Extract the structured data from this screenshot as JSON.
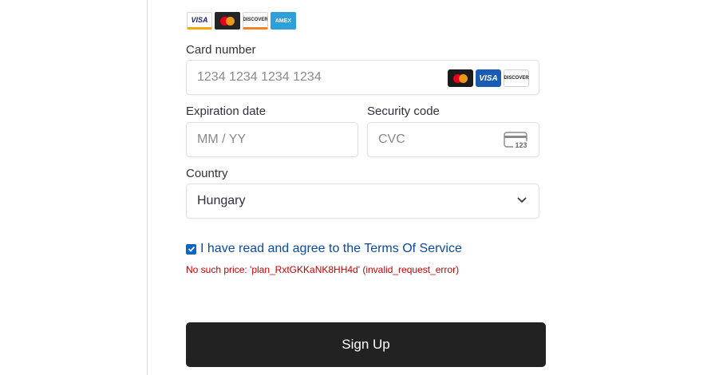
{
  "accepted_brands": [
    {
      "name": "VISA",
      "icon": "visa-icon"
    },
    {
      "name": "MasterCard",
      "icon": "mastercard-icon"
    },
    {
      "name": "DISCOVER",
      "icon": "discover-icon"
    },
    {
      "name": "AMEX",
      "icon": "amex-icon"
    }
  ],
  "card_number": {
    "label": "Card number",
    "placeholder": "1234 1234 1234 1234",
    "brands": [
      "mastercard-icon",
      "VISA",
      "DISCOVER"
    ]
  },
  "expiration": {
    "label": "Expiration date",
    "placeholder": "MM / YY"
  },
  "security": {
    "label": "Security code",
    "placeholder": "CVC",
    "icon_text": "123"
  },
  "country": {
    "label": "Country",
    "value": "Hungary"
  },
  "terms": {
    "checked": true,
    "text": "I have read and agree to the Terms Of Service"
  },
  "error": {
    "text": "No such price: 'plan_RxtGKKaNK8HH4d' (invalid_request_error)"
  },
  "signup_button": {
    "label": "Sign Up"
  },
  "colors": {
    "button_bg": "#222222",
    "link": "#0b4aa5",
    "error": "#c00000",
    "checkbox": "#0b64c8"
  }
}
